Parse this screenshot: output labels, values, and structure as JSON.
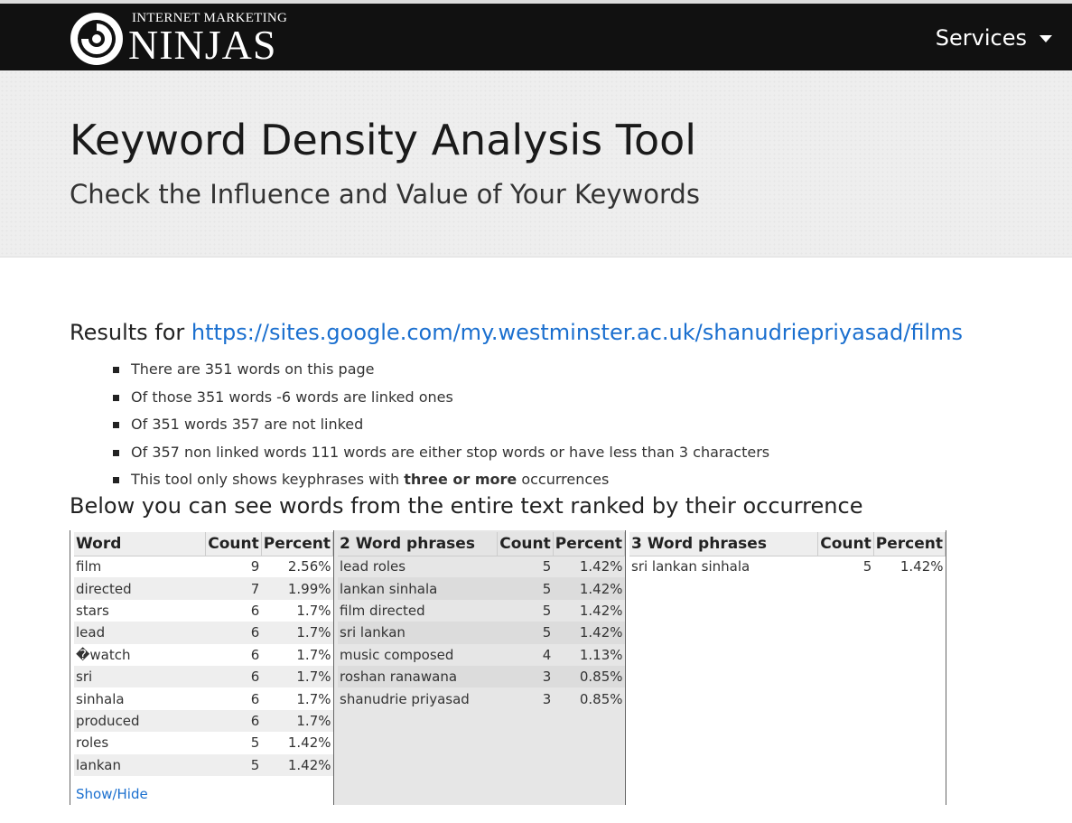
{
  "nav": {
    "logo_top": "INTERNET MARKETING",
    "logo_main": "NINJAS",
    "services_label": "Services"
  },
  "hero": {
    "title": "Keyword Density Analysis Tool",
    "subtitle": "Check the Influence and Value of Your Keywords"
  },
  "results": {
    "prefix": "Results for ",
    "url": "https://sites.google.com/my.westminster.ac.uk/shanudriepriyasad/films",
    "stats": [
      "There are 351 words on this page",
      "Of those 351 words -6 words are linked ones",
      "Of 351 words 357 are not linked",
      "Of 357 non linked words 111 words are either stop words or have less than 3 characters"
    ],
    "last_stat_before": "This tool only shows keyphrases with ",
    "last_stat_bold": "three or more",
    "last_stat_after": " occurrences",
    "below_heading": "Below you can see words from the entire text ranked by their occurrence"
  },
  "tables": {
    "words": {
      "headers": [
        "Word",
        "Count",
        "Percent"
      ],
      "rows": [
        [
          "film",
          "9",
          "2.56%"
        ],
        [
          "directed",
          "7",
          "1.99%"
        ],
        [
          "stars",
          "6",
          "1.7%"
        ],
        [
          "lead",
          "6",
          "1.7%"
        ],
        [
          "�watch",
          "6",
          "1.7%"
        ],
        [
          "sri",
          "6",
          "1.7%"
        ],
        [
          "sinhala",
          "6",
          "1.7%"
        ],
        [
          "produced",
          "6",
          "1.7%"
        ],
        [
          "roles",
          "5",
          "1.42%"
        ],
        [
          "lankan",
          "5",
          "1.42%"
        ]
      ],
      "show_hide": "Show/Hide"
    },
    "two_word": {
      "headers": [
        "2 Word phrases",
        "Count",
        "Percent"
      ],
      "rows": [
        [
          "lead roles",
          "5",
          "1.42%"
        ],
        [
          "lankan sinhala",
          "5",
          "1.42%"
        ],
        [
          "film directed",
          "5",
          "1.42%"
        ],
        [
          "sri lankan",
          "5",
          "1.42%"
        ],
        [
          "music composed",
          "4",
          "1.13%"
        ],
        [
          "roshan ranawana",
          "3",
          "0.85%"
        ],
        [
          "shanudrie priyasad",
          "3",
          "0.85%"
        ]
      ]
    },
    "three_word": {
      "headers": [
        "3 Word phrases",
        "Count",
        "Percent"
      ],
      "rows": [
        [
          "sri lankan sinhala",
          "5",
          "1.42%"
        ]
      ]
    }
  },
  "colors": {
    "nav_bg": "#111111",
    "link": "#1a6fcf",
    "hero_bg": "#eeeeee"
  }
}
